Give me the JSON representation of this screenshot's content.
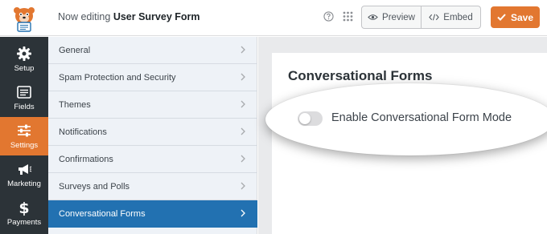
{
  "header": {
    "title_prefix": "Now editing",
    "form_name": "User Survey Form",
    "help_icon": "question-circle-icon",
    "apps_icon": "grid-dots-icon",
    "preview_label": "Preview",
    "embed_label": "Embed",
    "save_label": "Save"
  },
  "leftnav": {
    "items": [
      {
        "label": "Setup",
        "icon": "gear-icon"
      },
      {
        "label": "Fields",
        "icon": "fields-list-icon"
      },
      {
        "label": "Settings",
        "icon": "sliders-icon",
        "active": true
      },
      {
        "label": "Marketing",
        "icon": "megaphone-icon"
      },
      {
        "label": "Payments",
        "icon": "dollar-icon"
      }
    ]
  },
  "settings": {
    "items": [
      {
        "label": "General"
      },
      {
        "label": "Spam Protection and Security"
      },
      {
        "label": "Themes"
      },
      {
        "label": "Notifications"
      },
      {
        "label": "Confirmations"
      },
      {
        "label": "Surveys and Polls"
      },
      {
        "label": "Conversational Forms",
        "active": true
      }
    ]
  },
  "content": {
    "section_title": "Conversational Forms",
    "toggle_label": "Enable Conversational Form Mode",
    "toggle_enabled": false
  },
  "colors": {
    "accent_orange": "#e27730",
    "active_blue": "#2271b1",
    "nav_dark": "#2c3338"
  }
}
